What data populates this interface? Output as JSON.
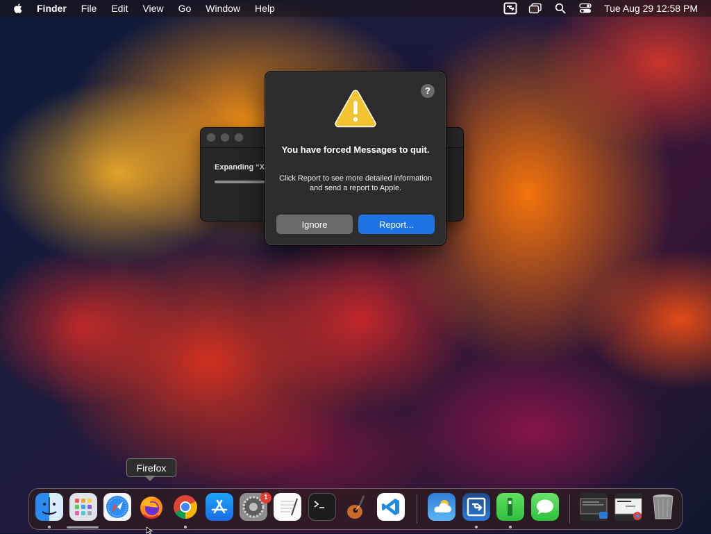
{
  "menubar": {
    "apple_icon": "apple-logo-icon",
    "app_name": "Finder",
    "menus": [
      "File",
      "Edit",
      "View",
      "Go",
      "Window",
      "Help"
    ],
    "status_icons": [
      "screen-share-icon",
      "window-switcher-icon",
      "spotlight-search-icon",
      "control-center-icon"
    ],
    "clock": "Tue Aug 29  12:58 PM"
  },
  "background_window": {
    "message": "Expanding “X",
    "progress": 0.22
  },
  "alert": {
    "title": "You have forced Messages to quit.",
    "body": "Click Report to see more detailed information and send a report to Apple.",
    "help_label": "?",
    "ignore_label": "Ignore",
    "report_label": "Report...",
    "icon": "warning-triangle-icon",
    "accent_color": "#1e74e4"
  },
  "tooltip": {
    "text": "Firefox"
  },
  "dock": {
    "apps": [
      {
        "name": "Finder",
        "icon": "finder-icon",
        "running": true
      },
      {
        "name": "Launchpad",
        "icon": "launchpad-icon",
        "running": false
      },
      {
        "name": "Safari",
        "icon": "safari-icon",
        "running": false
      },
      {
        "name": "Firefox",
        "icon": "firefox-icon",
        "running": false
      },
      {
        "name": "Google Chrome",
        "icon": "chrome-icon",
        "running": true
      },
      {
        "name": "App Store",
        "icon": "app-store-icon",
        "running": false
      },
      {
        "name": "System Settings",
        "icon": "system-settings-icon",
        "running": false,
        "badge": "1"
      },
      {
        "name": "TextEdit",
        "icon": "textedit-icon",
        "running": false
      },
      {
        "name": "Terminal",
        "icon": "terminal-icon",
        "running": false
      },
      {
        "name": "GarageBand",
        "icon": "garageband-icon",
        "running": false
      },
      {
        "name": "Visual Studio Code",
        "icon": "vscode-icon",
        "running": false
      },
      {
        "name": "Weather",
        "icon": "weather-icon",
        "running": false
      },
      {
        "name": "Remote Desktop",
        "icon": "remote-desktop-icon",
        "running": true
      },
      {
        "name": "FaceTime",
        "icon": "facetime-icon",
        "running": true
      },
      {
        "name": "Messages",
        "icon": "messages-icon",
        "running": false
      },
      {
        "name": "Minimized Window 1",
        "icon": "minimized-window-icon",
        "running": false
      },
      {
        "name": "Minimized Window 2",
        "icon": "minimized-chrome-window-icon",
        "running": false
      },
      {
        "name": "Trash",
        "icon": "trash-icon",
        "running": false
      }
    ]
  }
}
